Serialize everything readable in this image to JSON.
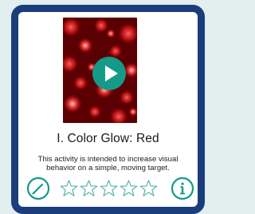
{
  "activity": {
    "title": "I. Color Glow: Red",
    "description": "This activity is intended to increase visual behavior on a simple, moving target.",
    "thumbnail_icon": "red-bokeh-image",
    "play_icon": "play-icon"
  },
  "rating": {
    "value": 0,
    "max": 5,
    "star_icon": "star-outline-icon"
  },
  "actions": {
    "edit_icon": "pencil-icon",
    "info_icon": "info-icon"
  },
  "colors": {
    "card_border": "#1b3d7c",
    "accent": "#159a8a",
    "thumbnail_base": "#6a0004",
    "background": "#e3efef"
  }
}
